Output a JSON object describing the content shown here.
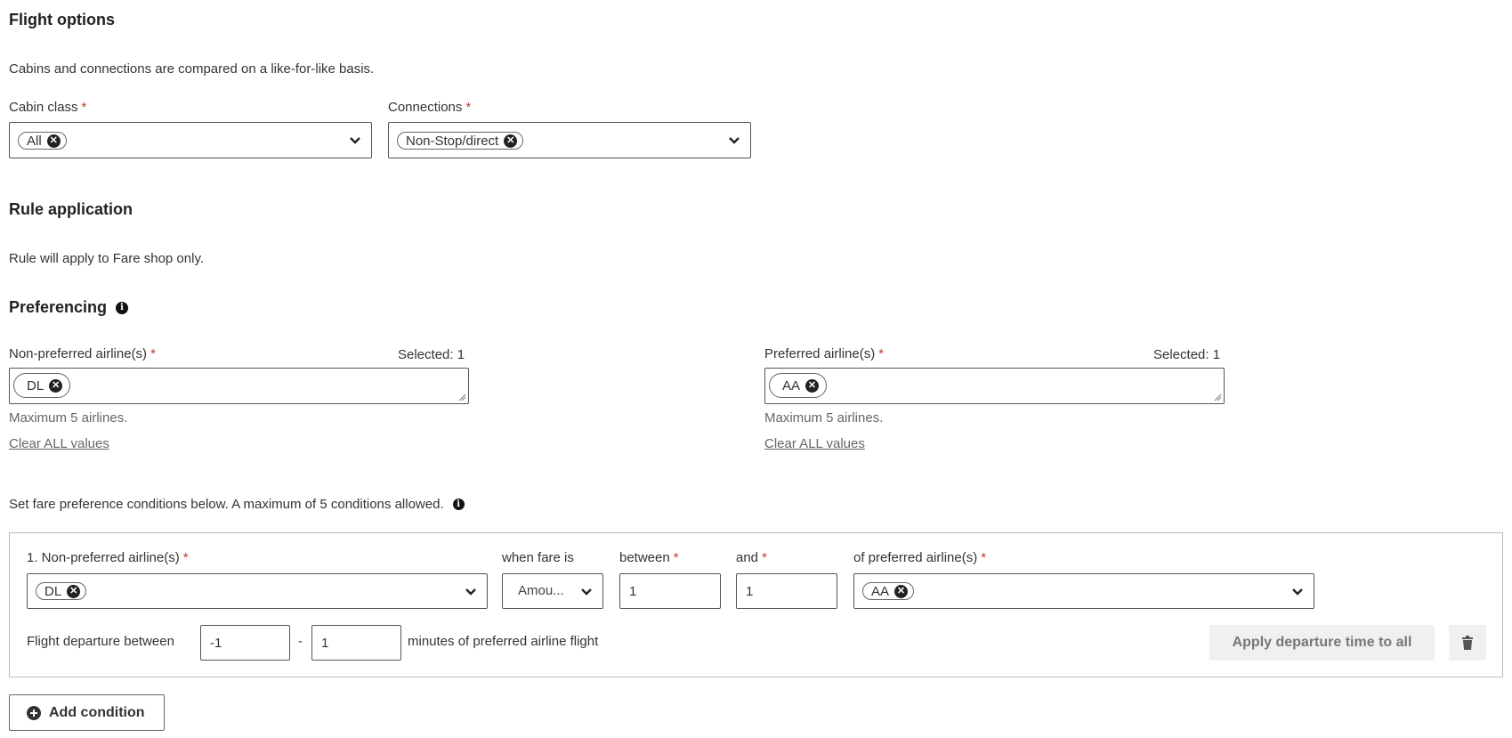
{
  "flight_options": {
    "heading": "Flight options",
    "description": "Cabins and connections are compared on a like-for-like basis.",
    "cabin_class": {
      "label": "Cabin class",
      "required": "*",
      "chips": [
        "All"
      ]
    },
    "connections": {
      "label": "Connections",
      "required": "*",
      "chips": [
        "Non-Stop/direct"
      ]
    }
  },
  "rule_application": {
    "heading": "Rule application",
    "description": "Rule will apply to Fare shop only."
  },
  "preferencing": {
    "heading": "Preferencing",
    "non_preferred": {
      "label": "Non-preferred airline(s)",
      "required": "*",
      "selected_text": "Selected: 1",
      "chips": [
        "DL"
      ],
      "help": "Maximum 5 airlines.",
      "clear_link": "Clear ALL values"
    },
    "preferred": {
      "label": "Preferred airline(s)",
      "required": "*",
      "selected_text": "Selected: 1",
      "chips": [
        "AA"
      ],
      "help": "Maximum 5 airlines.",
      "clear_link": "Clear ALL values"
    },
    "conditions_intro": "Set fare preference conditions below. A maximum of 5 conditions allowed."
  },
  "conditions": [
    {
      "non_preferred_label": "1. Non-preferred airline(s)",
      "non_preferred_chips": [
        "DL"
      ],
      "when_fare_label": "when fare is",
      "when_fare_value": "Amou...",
      "between_label": "between",
      "between_value": "1",
      "and_label": "and",
      "and_value": "1",
      "preferred_label": "of preferred airline(s)",
      "preferred_chips": [
        "AA"
      ],
      "required": "*",
      "departure_label": "Flight departure between",
      "departure_from": "-1",
      "departure_sep": "-",
      "departure_to": "1",
      "departure_suffix": "minutes of preferred airline flight",
      "apply_all_button": "Apply departure time to all"
    }
  ],
  "add_condition_button": "Add condition",
  "icons": {
    "remove": "x-circle-icon",
    "dropdown": "chevron-down-icon",
    "info": "info-icon",
    "delete": "trash-icon",
    "add": "plus-circle-icon"
  }
}
